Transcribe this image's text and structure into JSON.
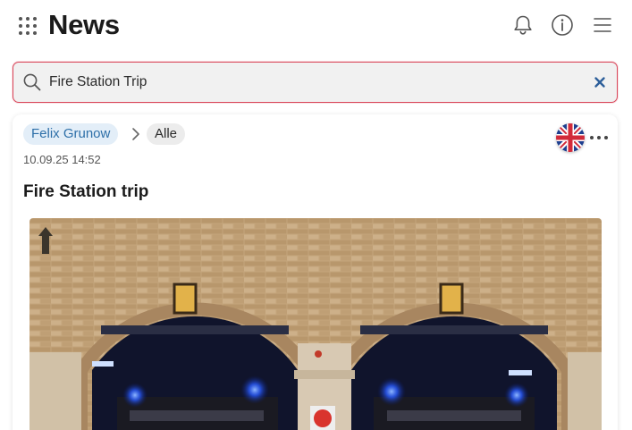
{
  "header": {
    "title": "News",
    "apps_icon": "grid-dots-icon",
    "notifications_icon": "bell-icon",
    "info_icon": "info-icon",
    "menu_icon": "hamburger-menu-icon"
  },
  "search": {
    "value": "Fire Station Trip",
    "icon": "search-icon",
    "clear_icon": "close-icon"
  },
  "post": {
    "author": "Felix Grunow",
    "category": "Alle",
    "timestamp": "10.09.25 14:52",
    "title": "Fire Station trip",
    "language_flag": "uk-flag-icon",
    "more_icon": "more-dots-icon"
  },
  "colors": {
    "accent_red": "#d9465a",
    "chip_blue_bg": "#e3eef8",
    "chip_blue_text": "#2d6fa8",
    "clear_icon_blue": "#2d5f9a"
  }
}
